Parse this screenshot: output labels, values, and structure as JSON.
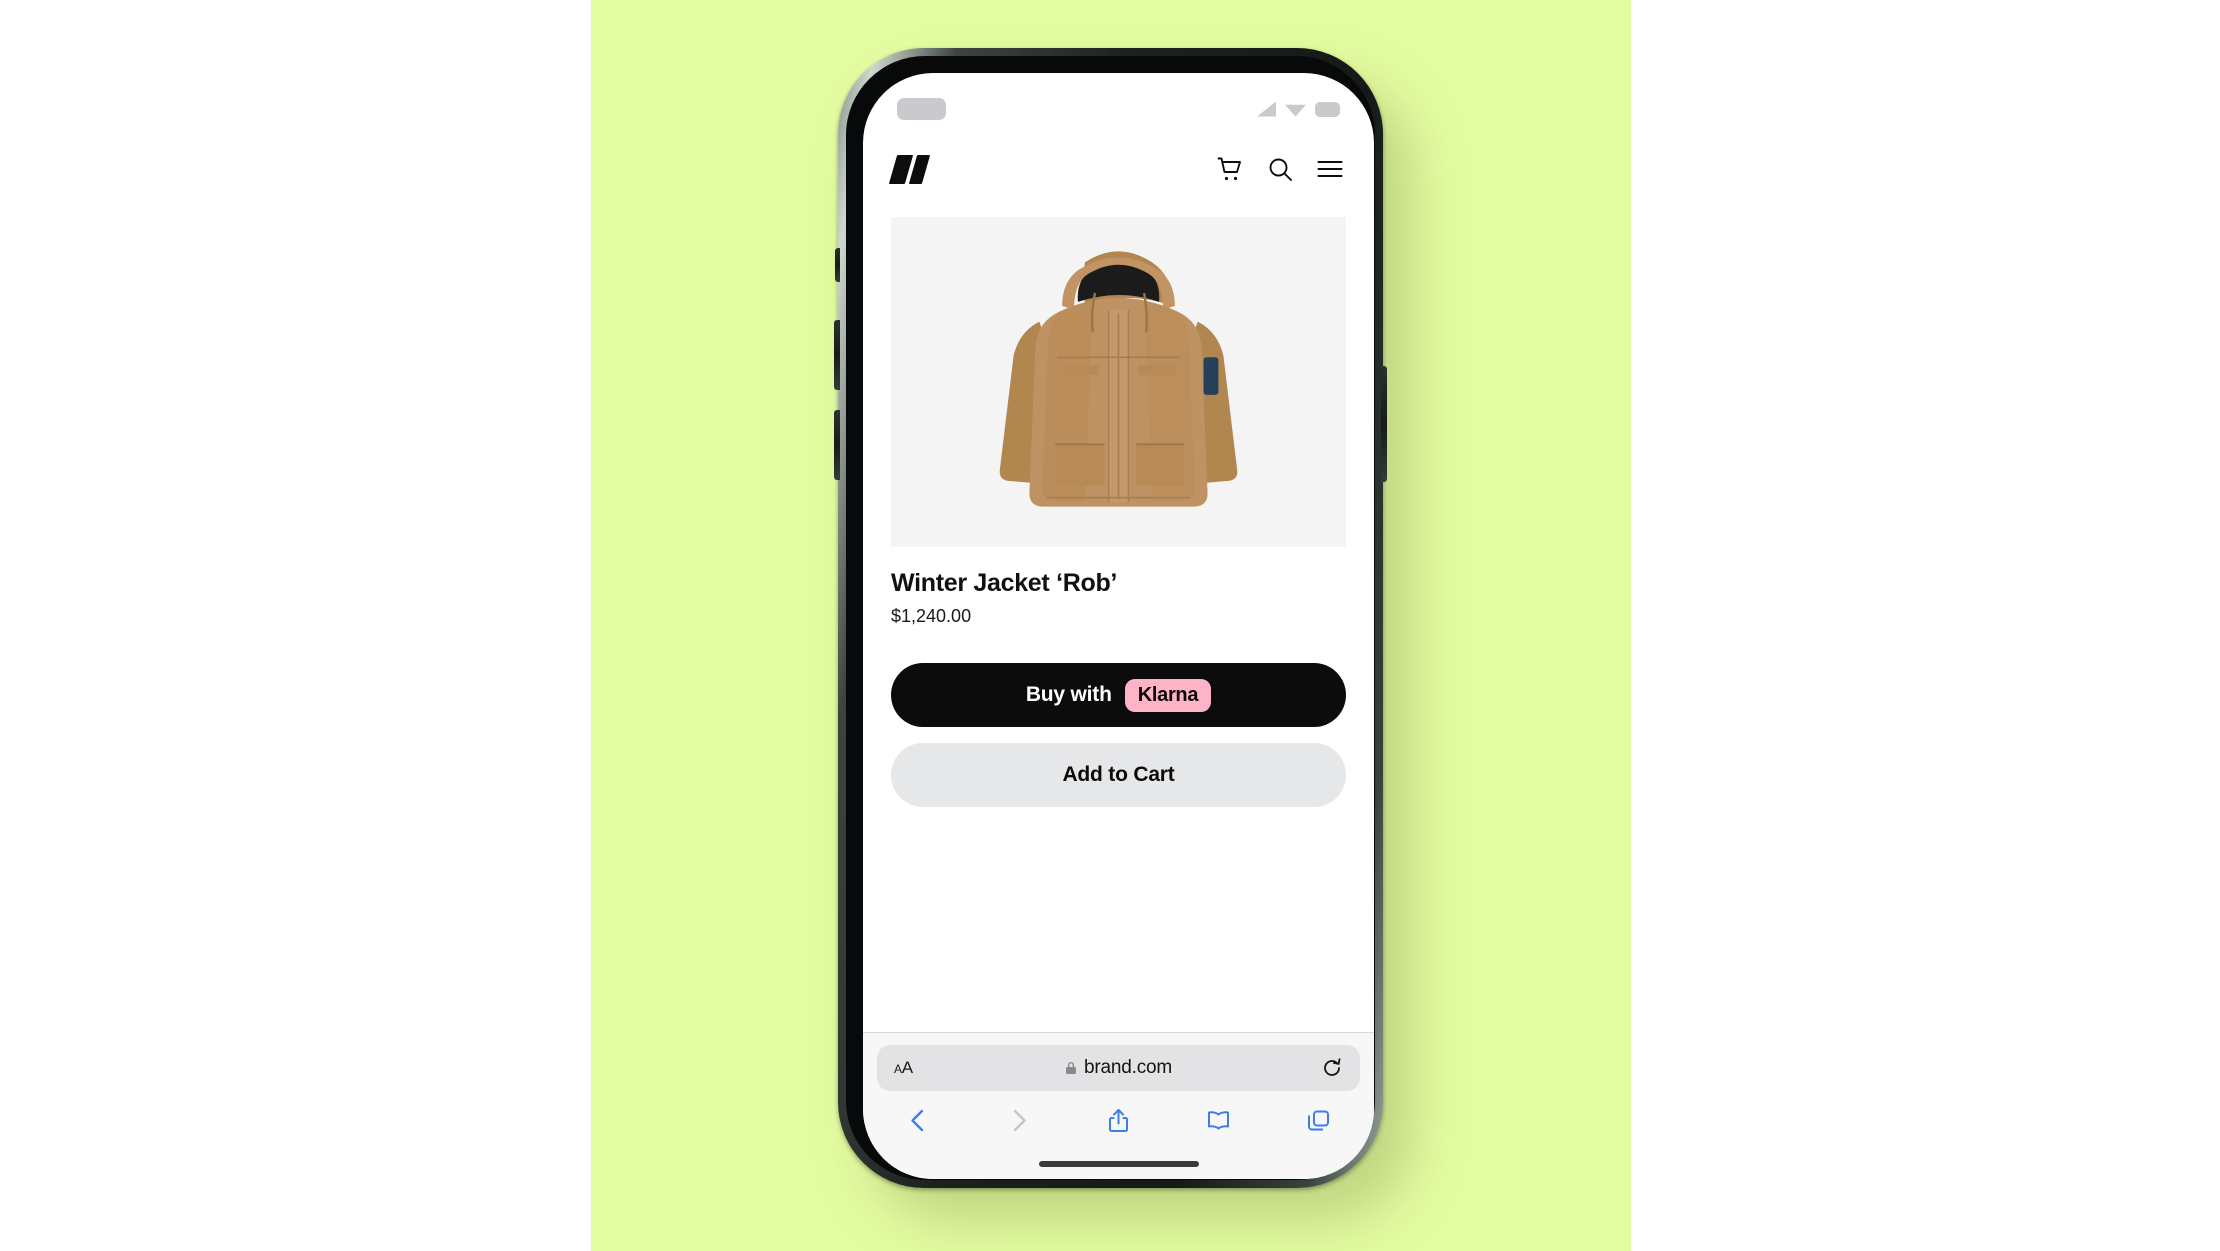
{
  "page": {
    "background_color": "#ffffff",
    "hero_background_color": "#e4fca1"
  },
  "phone": {
    "status_bar": {
      "time_placeholder": "",
      "icons": [
        "cellular-signal-icon",
        "wifi-icon",
        "battery-icon"
      ],
      "icon_color": "#c9cacd"
    },
    "home_indicator": ""
  },
  "site_header": {
    "logo_name": "brand-logo",
    "actions": [
      {
        "name": "cart-icon",
        "label": "Cart"
      },
      {
        "name": "search-icon",
        "label": "Search"
      },
      {
        "name": "menu-icon",
        "label": "Menu"
      }
    ]
  },
  "product": {
    "image_alt": "Winter parka jacket in camel tan with hood",
    "image_background": "#f4f4f4",
    "title": "Winter Jacket ‘Rob’",
    "price": "$1,240.00",
    "jacket_color": "#b98d5e",
    "hood_lining_color": "#1b1b1b",
    "sleeve_patch_color": "#24405a"
  },
  "cta": {
    "klarna": {
      "label": "Buy with",
      "badge": "Klarna",
      "badge_color": "#ffb3c7",
      "button_color": "#0c0c0c",
      "text_color": "#ffffff"
    },
    "add_to_cart": {
      "label": "Add to Cart",
      "button_color": "#e6e7e9",
      "text_color": "#0a0a0a"
    }
  },
  "browser": {
    "url_bar": {
      "text_size_button": "A",
      "text_size_button_small": "A",
      "lock_icon": "lock-icon",
      "url": "brand.com",
      "reload_icon": "reload-icon",
      "field_color": "#e3e3e5"
    },
    "toolbar": {
      "accent_color": "#3b7dea",
      "disabled_color": "#c2c3c6",
      "items": [
        {
          "name": "back-button",
          "label": "Back",
          "enabled": true
        },
        {
          "name": "forward-button",
          "label": "Forward",
          "enabled": false
        },
        {
          "name": "share-button",
          "label": "Share",
          "enabled": true
        },
        {
          "name": "bookmarks-button",
          "label": "Bookmarks",
          "enabled": true
        },
        {
          "name": "tabs-button",
          "label": "Tabs",
          "enabled": true
        }
      ]
    }
  }
}
